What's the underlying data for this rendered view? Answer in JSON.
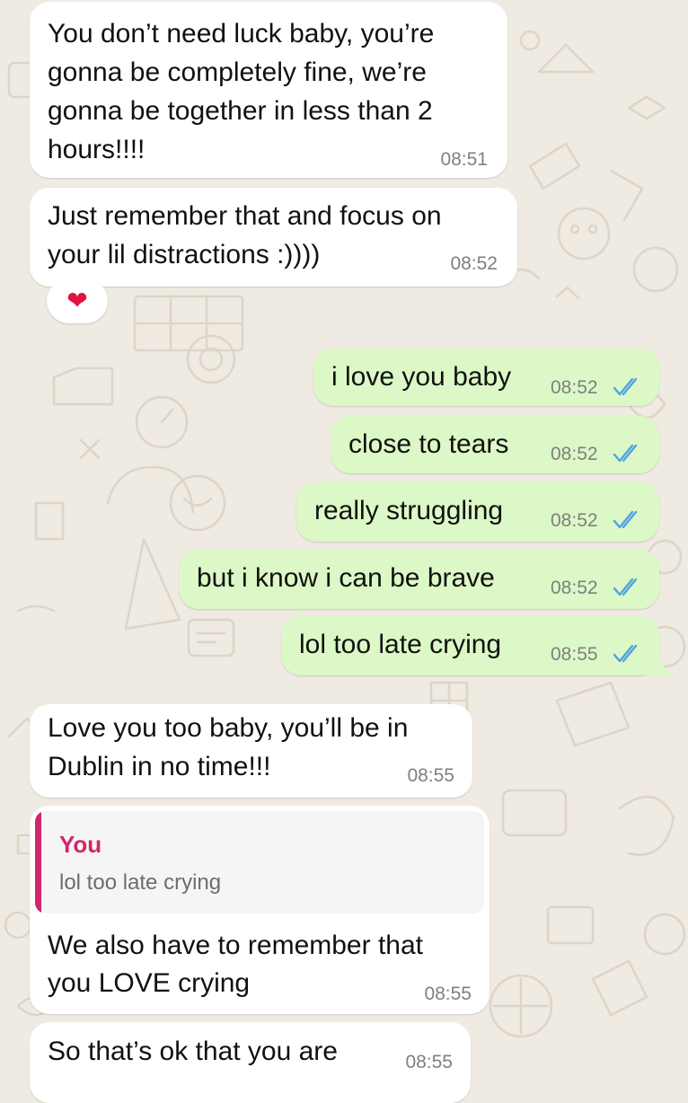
{
  "chat": {
    "m1": {
      "lines": [
        "You don’t need luck baby, you’re",
        "gonna be completely fine, we’re",
        "gonna be together in less than 2",
        "hours!!!!"
      ],
      "time": "08:51"
    },
    "m2": {
      "lines": [
        "Just remember that and focus on",
        "your lil distractions :))))"
      ],
      "time": "08:52",
      "reaction": "❤"
    },
    "m3": {
      "text": "i love you baby",
      "time": "08:52"
    },
    "m4": {
      "text": "close to tears",
      "time": "08:52"
    },
    "m5": {
      "text": "really struggling",
      "time": "08:52"
    },
    "m6": {
      "text": "but i know i can be brave",
      "time": "08:52"
    },
    "m7": {
      "text": "lol too late crying",
      "time": "08:55"
    },
    "m8": {
      "lines": [
        "Love you too baby, you’ll be in",
        "Dublin in no time!!!"
      ],
      "time": "08:55"
    },
    "m9": {
      "quote_author": "You",
      "quote_text": "lol too late crying",
      "lines": [
        "We also have to remember that",
        "you LOVE crying"
      ],
      "time": "08:55"
    },
    "m10": {
      "text": "So that’s ok that you are",
      "time": "08:55"
    }
  },
  "colors": {
    "incoming_bubble": "#ffffff",
    "outgoing_bubble": "#dcf8c6",
    "read_ticks": "#4fa3e0",
    "quote_accent": "#d3256b",
    "wallpaper": "#efeae2"
  },
  "icons": {
    "read_receipt": "double-check-icon",
    "reaction": "red-heart-icon"
  }
}
